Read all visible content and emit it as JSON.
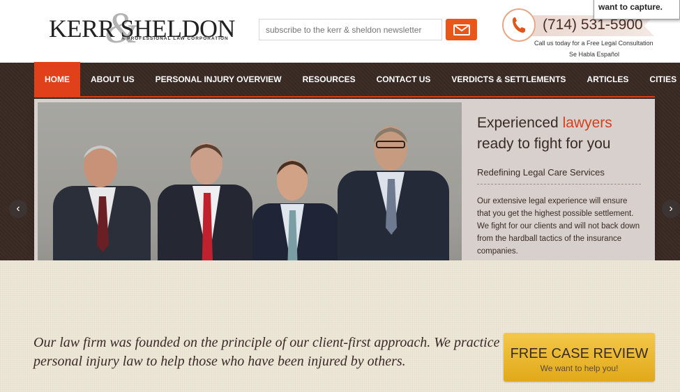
{
  "logo": {
    "name": "KERR SHELDON",
    "ampersand": "&",
    "tagline": "A PROFESSIONAL LAW CORPORATION"
  },
  "newsletter": {
    "placeholder": "subscribe to the kerr & sheldon newsletter",
    "button_icon": "mail-icon"
  },
  "phone": {
    "icon": "phone-icon",
    "number": "(714) 531-5900",
    "call_text": "Call us today for a Free Legal Consultation",
    "espanol": "Se Habla Español"
  },
  "tooltip": {
    "text": "want to capture."
  },
  "nav": {
    "items": [
      {
        "label": "HOME"
      },
      {
        "label": "ABOUT US"
      },
      {
        "label": "PERSONAL INJURY OVERVIEW"
      },
      {
        "label": "RESOURCES"
      },
      {
        "label": "CONTACT US"
      },
      {
        "label": "VERDICTS & SETTLEMENTS"
      },
      {
        "label": "ARTICLES"
      },
      {
        "label": "CITIES"
      }
    ]
  },
  "slide": {
    "heading_part1": "Experienced ",
    "heading_accent": "lawyers",
    "heading_part2": "ready to fight for you",
    "subheading": "Redefining Legal Care Services",
    "body": "Our extensive legal experience will ensure that you get the highest possible settlement. We fight for our clients and will not back down from the hardball tactics of the insurance companies."
  },
  "slider_controls": {
    "prev": "‹",
    "next": "›"
  },
  "tagline": {
    "text": "Our law firm was founded on the principle of our client-first approach. We practice personal injury law to help those who have been injured by others."
  },
  "cta": {
    "title": "FREE CASE REVIEW",
    "subtitle": "We want to help you!"
  },
  "colors": {
    "accent": "#e0411a",
    "dark_brown": "#3a2a24",
    "cta_gold": "#f3c84a"
  }
}
